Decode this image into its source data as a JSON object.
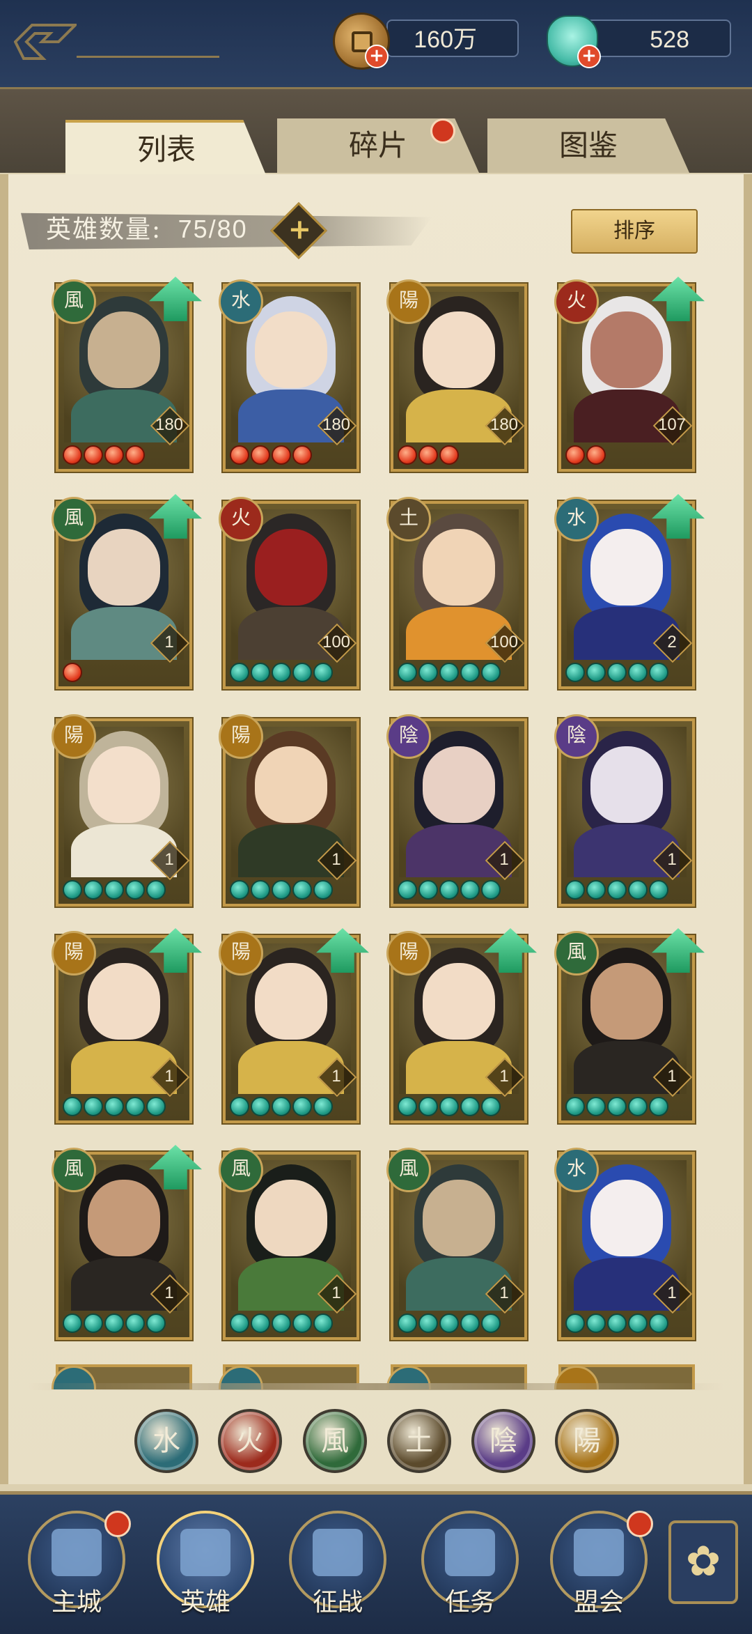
{
  "currency": {
    "coins": "160万",
    "jade": "528"
  },
  "tabs": [
    {
      "label": "列表",
      "active": true
    },
    {
      "label": "碎片",
      "active": false,
      "badge": true
    },
    {
      "label": "图鉴",
      "active": false
    }
  ],
  "hero_count": {
    "label": "英雄数量:",
    "value": "75/80"
  },
  "sort_button": "排序",
  "elements": {
    "water": {
      "glyph": "水",
      "color": "#2c6c77"
    },
    "fire": {
      "glyph": "火",
      "color": "#9c2a1c"
    },
    "wind": {
      "glyph": "風",
      "color": "#2f6a3a"
    },
    "earth": {
      "glyph": "土",
      "color": "#5b4a2c"
    },
    "yin": {
      "glyph": "陰",
      "color": "#5a3c87"
    },
    "yang": {
      "glyph": "陽",
      "color": "#a87419"
    }
  },
  "heroes": [
    {
      "element": "wind",
      "level": "180",
      "stars": 4,
      "star_color": "red",
      "upgrade": true,
      "palette": [
        "#2e3a3a",
        "#c7b090",
        "#3d6c5f"
      ]
    },
    {
      "element": "water",
      "level": "180",
      "stars": 4,
      "star_color": "red",
      "upgrade": false,
      "palette": [
        "#cfd4e4",
        "#f2ddc8",
        "#3c5ea5"
      ]
    },
    {
      "element": "yang",
      "level": "180",
      "stars": 3,
      "star_color": "red",
      "upgrade": false,
      "palette": [
        "#2a2420",
        "#f2dcc6",
        "#d6b34a"
      ]
    },
    {
      "element": "fire",
      "level": "107",
      "stars": 2,
      "star_color": "red",
      "upgrade": true,
      "palette": [
        "#e8e6e6",
        "#b47a68",
        "#4a1f22"
      ]
    },
    {
      "element": "wind",
      "level": "1",
      "stars": 1,
      "star_color": "red",
      "upgrade": true,
      "palette": [
        "#1e2a36",
        "#e8d4c0",
        "#5f8a82"
      ]
    },
    {
      "element": "fire",
      "level": "100",
      "stars": 5,
      "star_color": "green",
      "upgrade": false,
      "palette": [
        "#2b2726",
        "#9a1f1f",
        "#4c4033"
      ]
    },
    {
      "element": "earth",
      "level": "100",
      "stars": 5,
      "star_color": "green",
      "upgrade": false,
      "palette": [
        "#5a4a40",
        "#f0d4b6",
        "#e0922e"
      ]
    },
    {
      "element": "water",
      "level": "2",
      "stars": 5,
      "star_color": "green",
      "upgrade": true,
      "palette": [
        "#2a4bb0",
        "#f4eeee",
        "#27307a"
      ]
    },
    {
      "element": "yang",
      "level": "1",
      "stars": 5,
      "star_color": "green",
      "upgrade": false,
      "palette": [
        "#bfb49a",
        "#f3dfcb",
        "#ece6d4"
      ]
    },
    {
      "element": "yang",
      "level": "1",
      "stars": 5,
      "star_color": "green",
      "upgrade": false,
      "palette": [
        "#5a3a24",
        "#f0d4b6",
        "#2f3a26"
      ]
    },
    {
      "element": "yin",
      "level": "1",
      "stars": 5,
      "star_color": "green",
      "upgrade": false,
      "palette": [
        "#1e1e2c",
        "#e8d0c4",
        "#4c3468"
      ]
    },
    {
      "element": "yin",
      "level": "1",
      "stars": 5,
      "star_color": "green",
      "upgrade": false,
      "palette": [
        "#2a2448",
        "#e6e0ea",
        "#3c3470"
      ]
    },
    {
      "element": "yang",
      "level": "1",
      "stars": 5,
      "star_color": "green",
      "upgrade": true,
      "palette": [
        "#2a2420",
        "#f2dcc6",
        "#d6b34a"
      ]
    },
    {
      "element": "yang",
      "level": "1",
      "stars": 5,
      "star_color": "green",
      "upgrade": true,
      "palette": [
        "#2a2420",
        "#f2dcc6",
        "#d6b34a"
      ]
    },
    {
      "element": "yang",
      "level": "1",
      "stars": 5,
      "star_color": "green",
      "upgrade": true,
      "palette": [
        "#2a2420",
        "#f2dcc6",
        "#d6b34a"
      ]
    },
    {
      "element": "wind",
      "level": "1",
      "stars": 5,
      "star_color": "green",
      "upgrade": true,
      "palette": [
        "#1e1a18",
        "#c59a78",
        "#2a2622"
      ]
    },
    {
      "element": "wind",
      "level": "1",
      "stars": 5,
      "star_color": "green",
      "upgrade": true,
      "palette": [
        "#1e1a18",
        "#c59a78",
        "#2a2622"
      ]
    },
    {
      "element": "wind",
      "level": "1",
      "stars": 5,
      "star_color": "green",
      "upgrade": false,
      "palette": [
        "#1a1e1a",
        "#eed8c0",
        "#4a7a3a"
      ]
    },
    {
      "element": "wind",
      "level": "1",
      "stars": 5,
      "star_color": "green",
      "upgrade": false,
      "palette": [
        "#2e3a3a",
        "#c7b090",
        "#3d6c5f"
      ]
    },
    {
      "element": "water",
      "level": "1",
      "stars": 5,
      "star_color": "green",
      "upgrade": false,
      "palette": [
        "#2a4bb0",
        "#f4eeee",
        "#27307a"
      ]
    }
  ],
  "partial_row_elements": [
    "water",
    "water",
    "water",
    "yang"
  ],
  "filter_elements": [
    "water",
    "fire",
    "wind",
    "earth",
    "yin",
    "yang"
  ],
  "nav": [
    {
      "label": "主城",
      "badge": true,
      "active": false
    },
    {
      "label": "英雄",
      "badge": false,
      "active": true
    },
    {
      "label": "征战",
      "badge": false,
      "active": false
    },
    {
      "label": "任务",
      "badge": false,
      "active": false
    },
    {
      "label": "盟会",
      "badge": true,
      "active": false
    }
  ],
  "more_icon": "flower-menu-icon"
}
